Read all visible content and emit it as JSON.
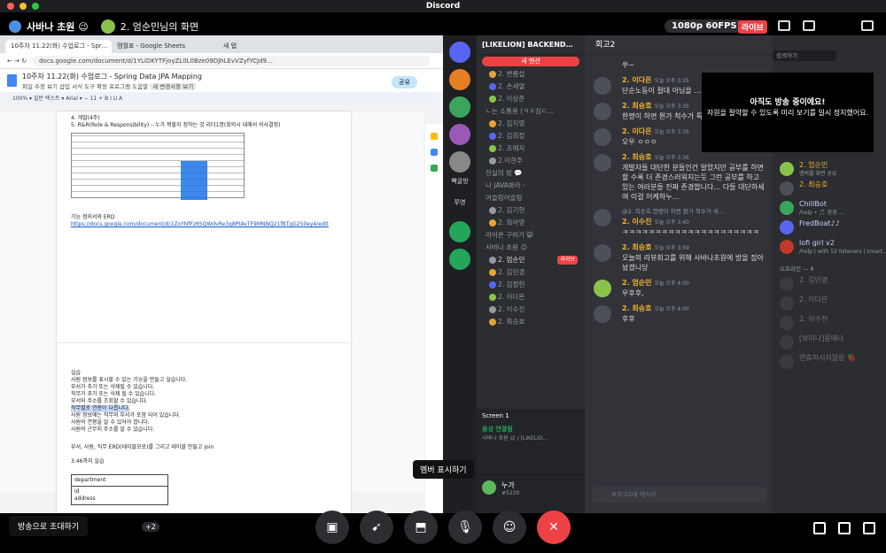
{
  "window": {
    "title": "Discord"
  },
  "stream_header": {
    "streamer_name": "사바나 초원 😉",
    "viewer_title": "2. 엄순민님의 화면",
    "quality": "1080p 60FPS",
    "live_label": "라이브"
  },
  "browser": {
    "tabs": [
      "10주차 11.22(화) 수업로그 - Spr…",
      "멤월표 - Google Sheets",
      "새 탭"
    ],
    "url": "docs.google.com/document/d/1YLiDKYTFjoyZL0L0Bze09DJhLEvVZyfYCJd9…",
    "doc_title": "10주차 11.22(화) 수업로그 - Spring Data JPA Mapping",
    "menus": "파일  수정  보기  삽입  서식  도구  확장 프로그램  도움말",
    "menu_extra": "새 변경사항 보기",
    "share_label": "공유",
    "toolbar_text": "100%  ▾   일반 텍스트  ▾   Arial  ▾   −  11  +   B  I  U  A",
    "doc_lines_top": [
      "4. 개발(4주)",
      "5. R&R(Role & Responsibility) – 누가 뭐할지 정하는 것 리더1명(회의시 대해서 의사결정)"
    ],
    "func_spec_title": "기능 정의서와 ERD",
    "func_spec_link": "https://docs.google.com/document/d/1ZoYNfFz6SQWdvRe3g8PtAvTF9MNNQ21fBTgG250ey4/edit",
    "practice_lines": [
      "실습",
      "사원 정보를 표시할 수 있는 기능을 만들고 싶습니다.",
      "부서가 추가 또는 삭제될 수 있습니다.",
      "직무가 추가 또는 삭제 될 수 있습니다.",
      "부서와 주소를 조회할 수 있습니다.",
      "직무별로 연봉이 다릅니다.",
      "사원 정보에는 직무와 부서가 포함 되어 있습니다.",
      "사원의 연봉을 알 수 있어야 합니다.",
      "사원의 근무지 주소를 알 수 있습니다."
    ],
    "erd_instruction": "부서, 사원, 직무 ERD(테이블모로)를 그리고 테이블 만들고 join",
    "erd_time": "3:46까지 실습",
    "erd_table": {
      "name": "department",
      "fields": [
        "id",
        "address"
      ]
    },
    "erd_table2": {
      "name": "job"
    }
  },
  "discord": {
    "app_label": "Discord",
    "server_name": "[LIKELION] BACKEND…",
    "new_mention": "새 멘션",
    "guild_labels": [
      "빡굴방",
      "쭈영"
    ],
    "channels": [
      {
        "type": "user",
        "label": "2. 변름섭"
      },
      {
        "type": "user",
        "label": "2. 손세열"
      },
      {
        "type": "user",
        "label": "2. 이상준"
      },
      {
        "type": "cat",
        "label": "ㄴ는 소통용 (ㅋㅈ심ㄷ…"
      },
      {
        "type": "user",
        "label": "2. 김지영"
      },
      {
        "type": "user",
        "label": "2. 김희정"
      },
      {
        "type": "user",
        "label": "2. 조예지"
      },
      {
        "type": "user",
        "label": "2.이현주"
      },
      {
        "type": "cat",
        "label": "진실의 방 💬"
      },
      {
        "type": "cat",
        "label": "나 JAVA봐라 -"
      },
      {
        "type": "cat",
        "label": "어슬렁어슬렁"
      },
      {
        "type": "user",
        "label": "2. 김기현"
      },
      {
        "type": "user",
        "label": "2. 최아영"
      },
      {
        "type": "cat",
        "label": "라이온 구하기 😸"
      },
      {
        "type": "cat",
        "label": "사바나 초원 😉"
      },
      {
        "type": "live",
        "label": "2. 엄순민",
        "badge": "라이브"
      },
      {
        "type": "user",
        "label": "2. 김민경"
      },
      {
        "type": "user",
        "label": "2. 김정현"
      },
      {
        "type": "user",
        "label": "2. 이다은"
      },
      {
        "type": "user",
        "label": "2. 이수진"
      },
      {
        "type": "user",
        "label": "2. 최승호"
      }
    ],
    "screen_label": "Screen 1",
    "voice_status": "음성 연결됨",
    "voice_channel": "사바나 초원 😉 / [LIKELIO…",
    "user_name": "누가",
    "user_tag": "#5230",
    "chat_channel": "회고2",
    "messages": [
      {
        "author": "",
        "time": "",
        "text": "쑤~"
      },
      {
        "author": "2. 이다은",
        "time": "오늘 오후 3:35",
        "text": "단순노동이 절대 아님을 … 뻐저리게 …"
      },
      {
        "author": "2. 최승호",
        "time": "오늘 오후 3:35",
        "text": "한명이 하면 뭔가 척수가 특 엎해어할듯…"
      },
      {
        "author": "2. 이다은",
        "time": "오늘 오후 3:35",
        "text": "오우 ㅇㅇㅇ"
      },
      {
        "author": "2. 최승호",
        "time": "오늘 오후 3:36",
        "text": "개발자들 대단한 분들인건 알았지만 공부를 하면 할 수록 더 존경스러워지는듯 그런 공부를 하고 있는 여러분들 진짜 존경합니다… 다들 대단하세여 이걸 어케하누…"
      },
      {
        "author": "2. 이수진",
        "time": "오늘 오후 3:40",
        "text": "ㅋㅋㅋㅋㅋㅋㅋㅋㅋㅋㅋㅋㅋㅋㅋㅋㅋㅋㅋㅋㅋ",
        "reply": "@2. 최승호 한명이 하면 뭔가 척수가 새…"
      },
      {
        "author": "2. 최승호",
        "time": "오늘 오후 3:59",
        "text": "오늘의 리뷰회고를 위해 사바나초원에 방을 잡아놨겠니당"
      },
      {
        "author": "2. 엄순민",
        "time": "오늘 오후 4:00",
        "text": "우후후,"
      },
      {
        "author": "2. 최승호",
        "time": "오늘 오후 4:00",
        "text": "후후"
      }
    ],
    "reaction_count": "1",
    "new_badge": "NEW",
    "input_placeholder": "#회고2에 메시지",
    "search_placeholder": "검색하기",
    "notice_title": "아직도 방송 중이에요!",
    "notice_body": "자원을 절약할 수 있도록 미리 보기를 일시 정지했어요.",
    "members": [
      {
        "name": "2. 엄순민",
        "sub": "엠버를 화면 공유"
      },
      {
        "name": "2. 최승호",
        "sub": ""
      },
      {
        "name": "ChillBot",
        "sub": "/help • 🎵 환경 …"
      },
      {
        "name": "FredBoat♪♪",
        "sub": ""
      },
      {
        "name": "lofi girl v2",
        "sub": "/help | with 52 listeners | smart…"
      }
    ],
    "offline_label": "오프라인 — 8",
    "offline_members": [
      "2. 김민경",
      "2. 이다은",
      "2. 이수진",
      "[보미나]몽애나",
      "연휴하시지말랑 🍓"
    ],
    "tooltip": "멤버 표시하기"
  },
  "bottom": {
    "invite_label": "방송으로 초대하기",
    "plus_count": "+2",
    "icons": [
      "camera-icon",
      "rocket-icon",
      "screen-share-icon",
      "microphone-icon",
      "emoji-icon",
      "end-stream-icon"
    ]
  }
}
